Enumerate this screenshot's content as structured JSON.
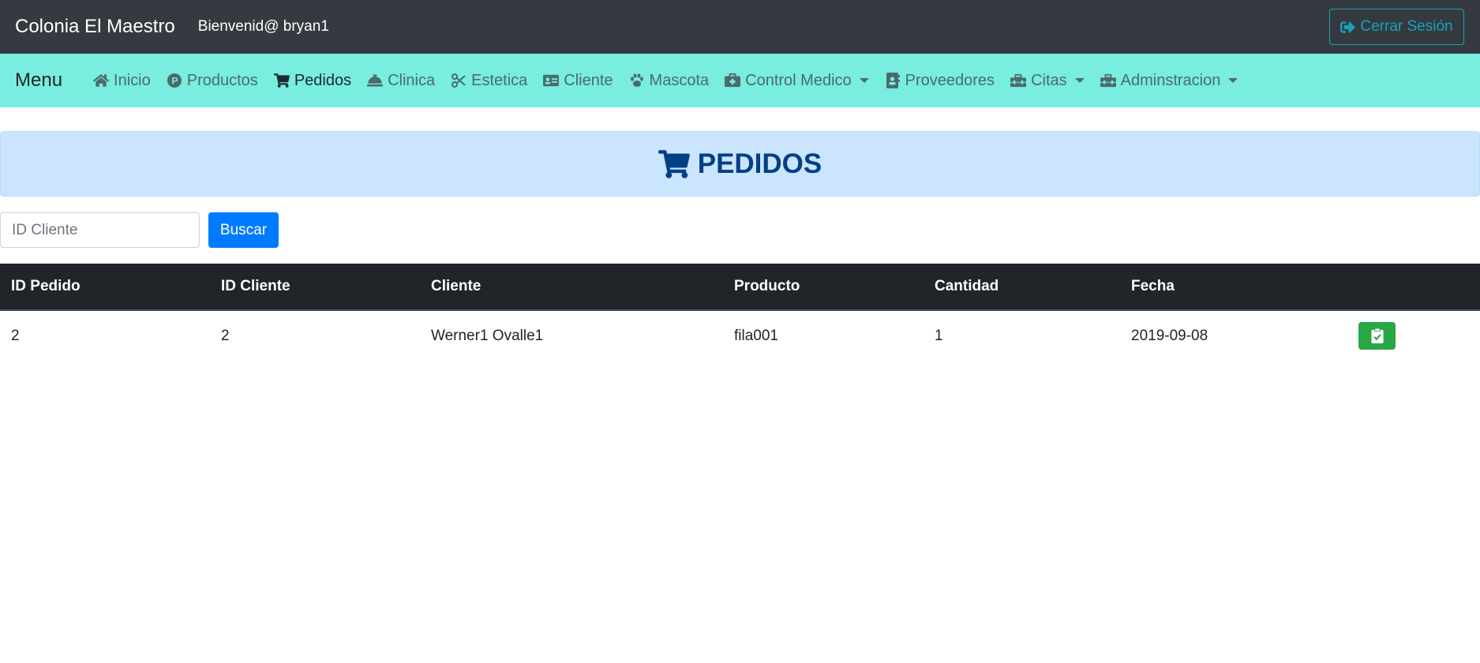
{
  "topbar": {
    "brand": "Colonia El Maestro",
    "welcome": "Bienvenid@ bryan1",
    "logout_label": "Cerrar Sesión"
  },
  "menubar": {
    "title": "Menu",
    "items": [
      {
        "label": "Inicio",
        "icon": "home-icon",
        "active": false,
        "dropdown": false
      },
      {
        "label": "Productos",
        "icon": "product-p-icon",
        "active": false,
        "dropdown": false
      },
      {
        "label": "Pedidos",
        "icon": "shopping-cart-icon",
        "active": true,
        "dropdown": false
      },
      {
        "label": "Clinica",
        "icon": "concierge-bell-icon",
        "active": false,
        "dropdown": false
      },
      {
        "label": "Estetica",
        "icon": "scissors-icon",
        "active": false,
        "dropdown": false
      },
      {
        "label": "Cliente",
        "icon": "id-card-icon",
        "active": false,
        "dropdown": false
      },
      {
        "label": "Mascota",
        "icon": "paw-icon",
        "active": false,
        "dropdown": false
      },
      {
        "label": "Control Medico",
        "icon": "medkit-icon",
        "active": false,
        "dropdown": true
      },
      {
        "label": "Proveedores",
        "icon": "address-book-icon",
        "active": false,
        "dropdown": false
      },
      {
        "label": "Citas",
        "icon": "toolbox-icon",
        "active": false,
        "dropdown": true
      },
      {
        "label": "Adminstracion",
        "icon": "toolbox-icon",
        "active": false,
        "dropdown": true
      }
    ]
  },
  "banner": {
    "title": "PEDIDOS",
    "icon": "shopping-cart-icon"
  },
  "search": {
    "placeholder": "ID Cliente",
    "button_label": "Buscar"
  },
  "table": {
    "headers": [
      "ID Pedido",
      "ID Cliente",
      "Cliente",
      "Producto",
      "Cantidad",
      "Fecha",
      ""
    ],
    "rows": [
      {
        "id_pedido": "2",
        "id_cliente": "2",
        "cliente": "Werner1 Ovalle1",
        "producto": "fila001",
        "cantidad": "1",
        "fecha": "2019-09-08",
        "action_icon": "clipboard-check-icon"
      }
    ]
  },
  "colors": {
    "topbar_bg": "#343a40",
    "menubar_bg": "#78ede0",
    "banner_bg": "#cce5ff",
    "banner_text": "#004085",
    "primary": "#007bff",
    "success": "#28a745",
    "info": "#17a2b8"
  }
}
